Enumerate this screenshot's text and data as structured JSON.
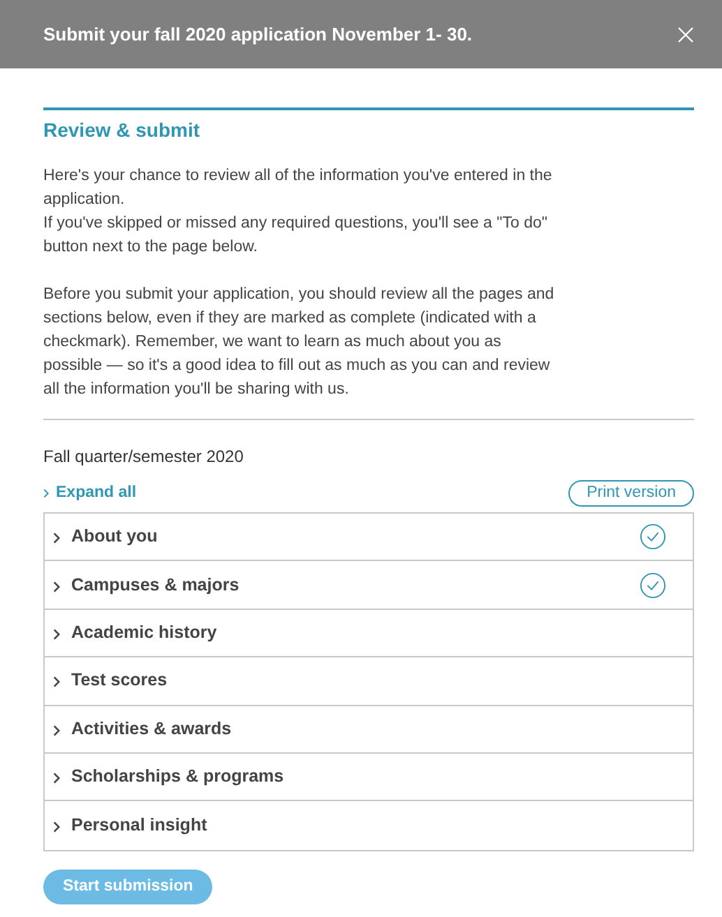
{
  "banner": {
    "text": "Submit your fall 2020 application November 1- 30."
  },
  "title": "Review & submit",
  "paragraphs": [
    [
      "Here's your chance to review all of the information you've entered in the application.",
      "If you've skipped or missed any required questions, you'll see a \"To do\" button next to the page below."
    ],
    [
      "Before you submit your application, you should review all the pages and sections below, even if they are marked as complete (indicated with a checkmark). Remember, we want to learn as much about you as possible — so it's a good idea to fill out as much as you can and review all the information you'll be sharing with us."
    ]
  ],
  "term": "Fall quarter/semester 2020",
  "expand_all": "Expand all",
  "print_button": "Print version",
  "sections": [
    {
      "label": "About you",
      "complete": true
    },
    {
      "label": "Campuses & majors",
      "complete": true
    },
    {
      "label": "Academic history",
      "complete": false
    },
    {
      "label": "Test scores",
      "complete": false
    },
    {
      "label": "Activities & awards",
      "complete": false
    },
    {
      "label": "Scholarships & programs",
      "complete": false
    },
    {
      "label": "Personal insight",
      "complete": false
    }
  ],
  "submit_button": {
    "label": "Start submission",
    "disabled": true
  }
}
